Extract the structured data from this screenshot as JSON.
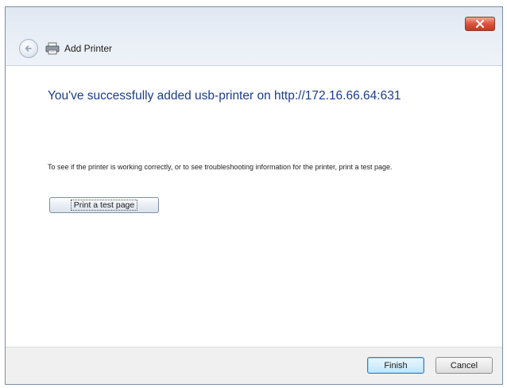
{
  "window": {
    "title": "Add Printer"
  },
  "content": {
    "heading": "You've successfully added usb-printer on http://172.16.66.64:631",
    "info_text": "To see if the printer is working correctly, or to see troubleshooting information for the printer, print a test page.",
    "test_page_button": "Print a test page"
  },
  "footer": {
    "finish_label": "Finish",
    "cancel_label": "Cancel"
  },
  "colors": {
    "heading": "#1c3c8c",
    "close_button": "#d9553c",
    "finish_border": "#3c7fb1"
  },
  "icons": {
    "back": "back-arrow-icon",
    "printer": "printer-icon",
    "close": "close-icon"
  }
}
